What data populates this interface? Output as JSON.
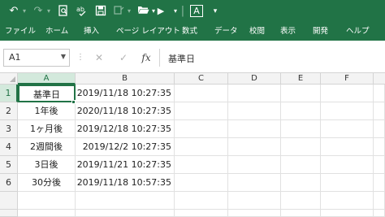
{
  "quick_access": {
    "undo_icon": "undo-icon",
    "redo_icon": "redo-icon",
    "separator": "|",
    "font_box_letter": "A",
    "menu_arrow": "▾"
  },
  "ribbon": {
    "tabs": [
      "ファイル",
      "ホーム",
      "挿入",
      "ページ レイアウト",
      "数式",
      "データ",
      "校閲",
      "表示",
      "開発",
      "ヘルプ"
    ]
  },
  "formula_bar": {
    "name_box": "A1",
    "cancel_symbol": "✕",
    "enter_symbol": "✓",
    "fx_symbol": "fx",
    "content": "基準日"
  },
  "sheet": {
    "columns": [
      "A",
      "B",
      "C",
      "D",
      "E",
      "F"
    ],
    "rows": [
      "1",
      "2",
      "3",
      "4",
      "5",
      "6"
    ],
    "cells": [
      {
        "a": "基準日",
        "b": "2019/11/18 10:27:35"
      },
      {
        "a": "1年後",
        "b": "2020/11/18 10:27:35"
      },
      {
        "a": "1ヶ月後",
        "b": "2019/12/18 10:27:35"
      },
      {
        "a": "2週間後",
        "b": "2019/12/2 10:27:35"
      },
      {
        "a": "3日後",
        "b": "2019/11/21 10:27:35"
      },
      {
        "a": "30分後",
        "b": "2019/11/18 10:57:35"
      }
    ]
  },
  "colors": {
    "accent": "#217346",
    "header_bg": "#f3f3f3",
    "selected_header_bg": "#d3e9dc"
  }
}
